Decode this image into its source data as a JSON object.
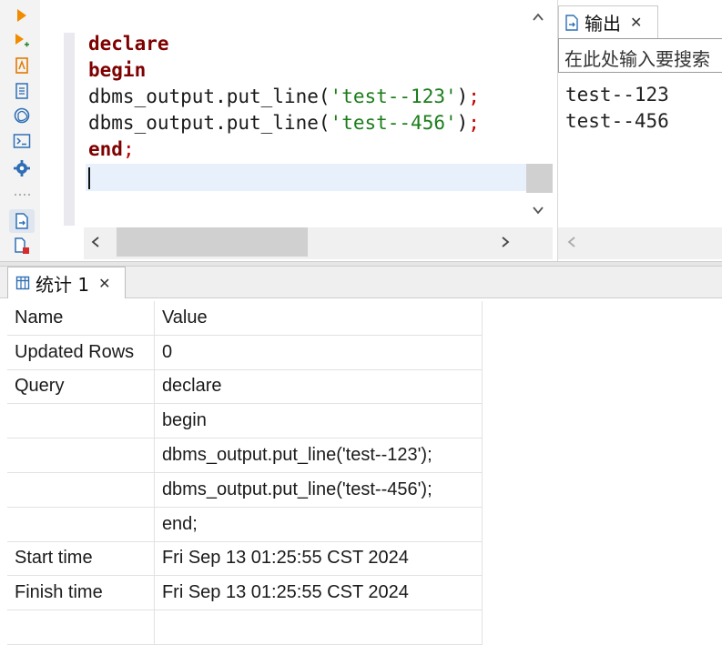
{
  "editor": {
    "lines": [
      {
        "parts": [
          {
            "t": "declare",
            "c": "kw"
          }
        ]
      },
      {
        "parts": [
          {
            "t": "begin",
            "c": "kw"
          }
        ]
      },
      {
        "parts": [
          {
            "t": "dbms_output",
            "c": "fn"
          },
          {
            "t": ".",
            "c": "pun"
          },
          {
            "t": "put_line",
            "c": "fn"
          },
          {
            "t": "(",
            "c": "pun"
          },
          {
            "t": "'test--123'",
            "c": "str"
          },
          {
            "t": ")",
            "c": "pun"
          },
          {
            "t": ";",
            "c": "semi"
          }
        ]
      },
      {
        "parts": [
          {
            "t": "dbms_output",
            "c": "fn"
          },
          {
            "t": ".",
            "c": "pun"
          },
          {
            "t": "put_line",
            "c": "fn"
          },
          {
            "t": "(",
            "c": "pun"
          },
          {
            "t": "'test--456'",
            "c": "str"
          },
          {
            "t": ")",
            "c": "pun"
          },
          {
            "t": ";",
            "c": "semi"
          }
        ]
      },
      {
        "parts": [
          {
            "t": "end",
            "c": "kw"
          },
          {
            "t": ";",
            "c": "semi"
          }
        ]
      }
    ]
  },
  "output": {
    "tab_label": "输出",
    "search_placeholder": "在此处输入要搜索",
    "lines": [
      "test--123",
      "test--456"
    ]
  },
  "stats": {
    "tab_label": "统计 1",
    "rows": [
      [
        "Name",
        "Value"
      ],
      [
        "Updated Rows",
        "0"
      ],
      [
        "Query",
        "declare"
      ],
      [
        "",
        "begin"
      ],
      [
        "",
        "dbms_output.put_line('test--123');"
      ],
      [
        "",
        "dbms_output.put_line('test--456');"
      ],
      [
        "",
        "end;"
      ],
      [
        "Start time",
        "Fri Sep 13 01:25:55 CST 2024"
      ],
      [
        "Finish time",
        "Fri Sep 13 01:25:55 CST 2024"
      ],
      [
        "",
        ""
      ]
    ]
  },
  "toolbar": {
    "icons": [
      "run-icon",
      "run-step-icon",
      "explain-icon",
      "script-icon",
      "ai-icon",
      "terminal-icon",
      "settings-icon",
      "more-icon",
      "new-file-icon",
      "stop-file-icon"
    ]
  },
  "colors": {
    "keyword": "#7f0000",
    "string": "#1b7d1b",
    "current_line": "#e8f0fb",
    "run": "#f08c00"
  }
}
